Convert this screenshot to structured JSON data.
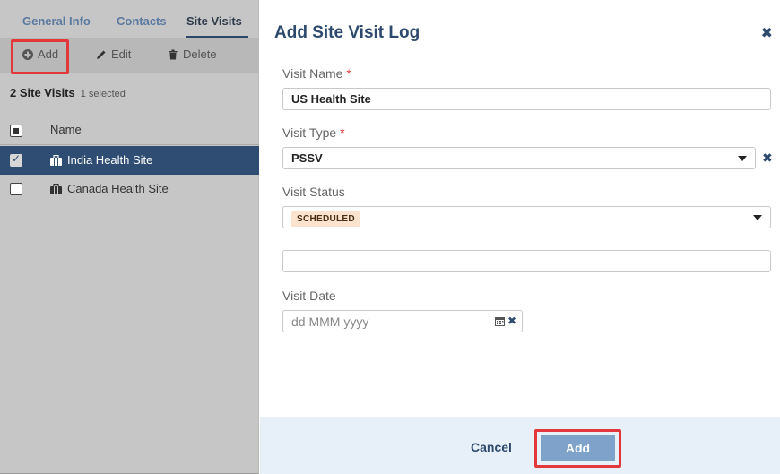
{
  "tabs": [
    "General Info",
    "Contacts",
    "Site Visits"
  ],
  "toolbar": {
    "add": "Add",
    "edit": "Edit",
    "delete": "Delete"
  },
  "list": {
    "count_label": "2 Site Visits",
    "selected_label": "1 selected",
    "column_name": "Name",
    "rows": [
      {
        "name": "India Health Site",
        "selected": true
      },
      {
        "name": "Canada Health Site",
        "selected": false
      }
    ]
  },
  "dialog": {
    "title": "Add Site Visit Log",
    "close": "✖",
    "visit_name_label": "Visit Name",
    "visit_name_value": "US Health Site",
    "visit_type_label": "Visit Type",
    "visit_type_value": "PSSV",
    "visit_status_label": "Visit Status",
    "visit_status_value": "SCHEDULED",
    "extra_field_value": "",
    "visit_date_label": "Visit Date",
    "visit_date_placeholder": "dd MMM yyyy",
    "required_marker": "*",
    "cancel": "Cancel",
    "add": "Add"
  },
  "colors": {
    "selected_row": "#2f4d72",
    "accent": "#2d4a6e",
    "highlight": "#e2383b",
    "status_badge_bg": "#fbe3cf",
    "footer_bg": "#e7f0f8",
    "primary_button": "#7ea2c9"
  }
}
